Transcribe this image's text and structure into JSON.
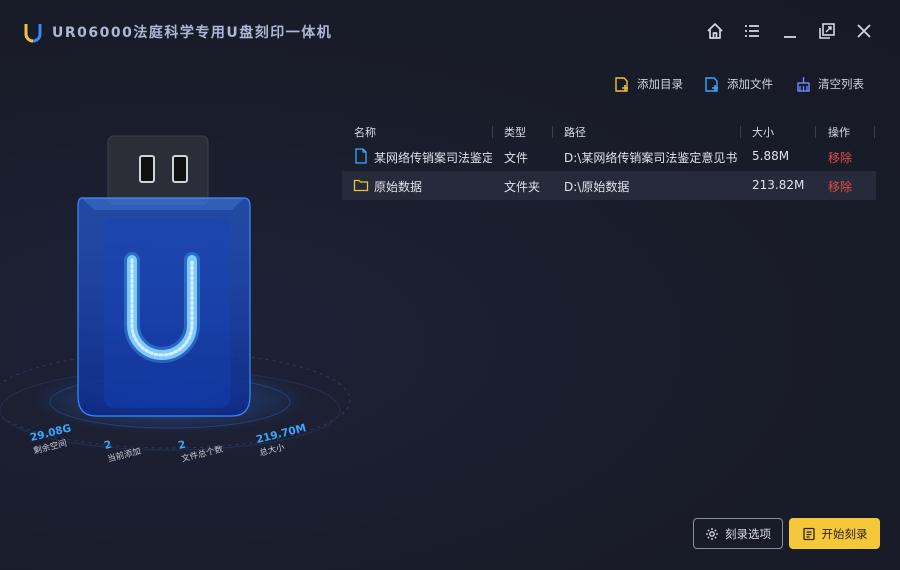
{
  "app": {
    "title": "UR06000法庭科学专用U盘刻印一体机",
    "logo_letter": "U"
  },
  "window_controls": [
    {
      "name": "home-icon"
    },
    {
      "name": "menu-icon"
    },
    {
      "name": "minimize-icon"
    },
    {
      "name": "restore-icon"
    },
    {
      "name": "close-icon"
    }
  ],
  "toolbar": {
    "add_dir": "添加目录",
    "add_file": "添加文件",
    "clear_list": "清空列表"
  },
  "table": {
    "headers": {
      "name": "名称",
      "type": "类型",
      "path": "路径",
      "size": "大小",
      "action": "操作"
    },
    "rows": [
      {
        "icon": "file-icon",
        "name": "某网络传销案司法鉴定",
        "type": "文件",
        "path": "D:\\某网络传销案司法鉴定意见书",
        "size": "5.88M",
        "action": "移除"
      },
      {
        "icon": "folder-icon",
        "name": "原始数据",
        "type": "文件夹",
        "path": "D:\\原始数据",
        "size": "213.82M",
        "action": "移除"
      }
    ]
  },
  "stats": {
    "free_space": {
      "value": "29.08G",
      "label": "剩余空间"
    },
    "current_added": {
      "value": "2",
      "label": "当前添加"
    },
    "file_count": {
      "value": "2",
      "label": "文件总个数"
    },
    "total_size": {
      "value": "219.70M",
      "label": "总大小"
    }
  },
  "buttons": {
    "options": "刻录选项",
    "start": "开始刻录"
  },
  "colors": {
    "accent_blue": "#3aa7ff",
    "accent_yellow": "#f5c83a",
    "danger": "#e24a4a"
  }
}
